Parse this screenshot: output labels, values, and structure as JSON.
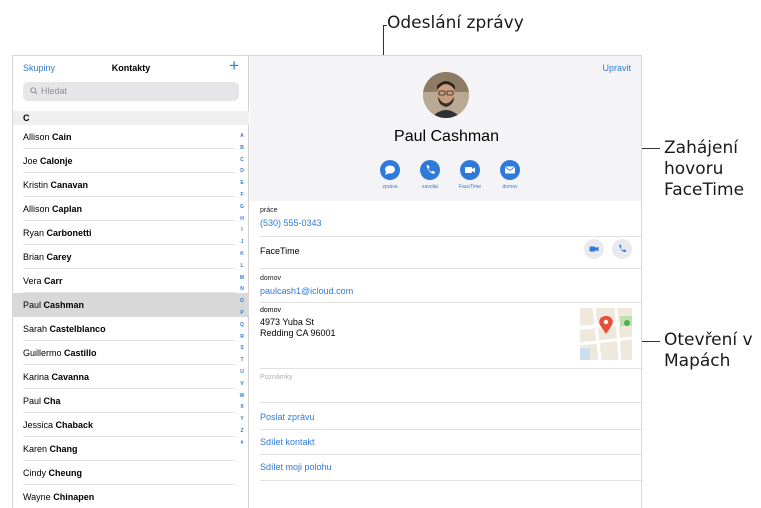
{
  "callouts": {
    "message": "Odeslání zprávy",
    "facetime": [
      "Zahájení",
      "hovoru",
      "FaceTime"
    ],
    "maps": [
      "Otevření v",
      "Mapách"
    ]
  },
  "left_pane": {
    "groups_label": "Skupiny",
    "title": "Kontakty",
    "add_label": "+",
    "search_placeholder": "Hledat",
    "section_letter": "C",
    "contacts": [
      {
        "first": "Allison",
        "last": "Cain"
      },
      {
        "first": "Joe",
        "last": "Calonje"
      },
      {
        "first": "Kristin",
        "last": "Canavan"
      },
      {
        "first": "Allison",
        "last": "Caplan"
      },
      {
        "first": "Ryan",
        "last": "Carbonetti"
      },
      {
        "first": "Brian",
        "last": "Carey"
      },
      {
        "first": "Vera",
        "last": "Carr"
      },
      {
        "first": "Paul",
        "last": "Cashman"
      },
      {
        "first": "Sarah",
        "last": "Castelblanco"
      },
      {
        "first": "Guillermo",
        "last": "Castillo"
      },
      {
        "first": "Karina",
        "last": "Cavanna"
      },
      {
        "first": "Paul",
        "last": "Cha"
      },
      {
        "first": "Jessica",
        "last": "Chaback"
      },
      {
        "first": "Karen",
        "last": "Chang"
      },
      {
        "first": "Cindy",
        "last": "Cheung"
      },
      {
        "first": "Wayne",
        "last": "Chinapen"
      }
    ],
    "selected_index": 7,
    "index_letters": [
      "A",
      "B",
      "C",
      "D",
      "E",
      "F",
      "G",
      "H",
      "I",
      "J",
      "K",
      "L",
      "M",
      "N",
      "O",
      "P",
      "Q",
      "R",
      "S",
      "T",
      "U",
      "V",
      "W",
      "X",
      "Y",
      "Z",
      "#"
    ]
  },
  "detail": {
    "edit_label": "Upravit",
    "name": "Paul Cashman",
    "actions": [
      {
        "label": "zpráva",
        "icon": "message-icon"
      },
      {
        "label": "zavolat",
        "icon": "phone-icon"
      },
      {
        "label": "FaceTime",
        "icon": "video-icon"
      },
      {
        "label": "domov",
        "icon": "mail-icon"
      }
    ],
    "phone_label": "práce",
    "phone": "(530) 555-0343",
    "facetime_label": "FaceTime",
    "email_label": "domov",
    "email": "paulcash1@icloud.com",
    "address_label": "domov",
    "address_line1": "4973 Yuba St",
    "address_line2": "Redding CA 96001",
    "notes_label": "Poznámky",
    "links": [
      "Poslat zprávu",
      "Sdílet kontakt",
      "Sdílet moji polohu"
    ]
  },
  "colors": {
    "accent": "#2f7ad8",
    "map_pin": "#e8503a"
  }
}
